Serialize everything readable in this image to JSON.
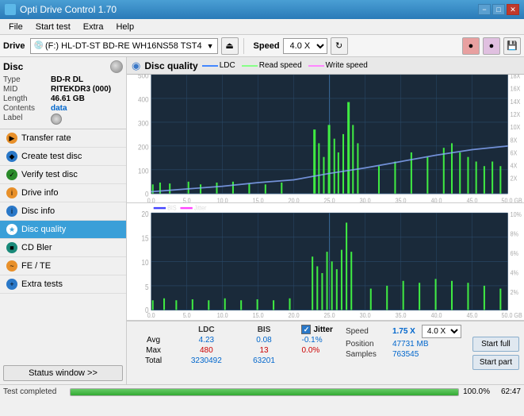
{
  "titlebar": {
    "title": "Opti Drive Control 1.70",
    "minimize": "−",
    "maximize": "□",
    "close": "✕"
  },
  "menubar": {
    "items": [
      "File",
      "Start test",
      "Extra",
      "Help"
    ]
  },
  "toolbar": {
    "drive_label": "Drive",
    "drive_value": "(F:)  HL-DT-ST BD-RE  WH16NS58 TST4",
    "speed_label": "Speed",
    "speed_value": "4.0 X"
  },
  "sidebar": {
    "disc_section": {
      "title": "Disc",
      "rows": [
        {
          "key": "Type",
          "value": "BD-R DL",
          "style": "normal"
        },
        {
          "key": "MID",
          "value": "RITEKDR3 (000)",
          "style": "normal"
        },
        {
          "key": "Length",
          "value": "46.61 GB",
          "style": "normal"
        },
        {
          "key": "Contents",
          "value": "data",
          "style": "blue"
        },
        {
          "key": "Label",
          "value": "",
          "style": "normal"
        }
      ]
    },
    "menu_items": [
      {
        "label": "Transfer rate",
        "icon": "orange",
        "active": false
      },
      {
        "label": "Create test disc",
        "icon": "blue",
        "active": false
      },
      {
        "label": "Verify test disc",
        "icon": "green",
        "active": false
      },
      {
        "label": "Drive info",
        "icon": "orange",
        "active": false
      },
      {
        "label": "Disc info",
        "icon": "blue",
        "active": false
      },
      {
        "label": "Disc quality",
        "icon": "cyan",
        "active": true
      },
      {
        "label": "CD Bler",
        "icon": "teal",
        "active": false
      },
      {
        "label": "FE / TE",
        "icon": "orange",
        "active": false
      },
      {
        "label": "Extra tests",
        "icon": "blue",
        "active": false
      }
    ],
    "status_btn": "Status window >>"
  },
  "content": {
    "title": "Disc quality",
    "legend": [
      {
        "label": "LDC",
        "color": "ldc"
      },
      {
        "label": "Read speed",
        "color": "read"
      },
      {
        "label": "Write speed",
        "color": "write"
      }
    ],
    "chart1": {
      "y_max": 500,
      "y_labels": [
        "500",
        "400",
        "300",
        "200",
        "100",
        "0"
      ],
      "y_right": [
        "18X",
        "16X",
        "14X",
        "12X",
        "10X",
        "8X",
        "6X",
        "4X",
        "2X"
      ],
      "x_labels": [
        "0.0",
        "5.0",
        "10.0",
        "15.0",
        "20.0",
        "25.0",
        "30.0",
        "35.0",
        "40.0",
        "45.0",
        "50.0 GB"
      ]
    },
    "chart2": {
      "legend": [
        "BIS",
        "Jitter"
      ],
      "y_max": 20,
      "y_labels": [
        "20",
        "15",
        "10",
        "5",
        "0"
      ],
      "y_right": [
        "10%",
        "8%",
        "6%",
        "4%",
        "2%"
      ],
      "x_labels": [
        "0.0",
        "5.0",
        "10.0",
        "15.0",
        "20.0",
        "25.0",
        "30.0",
        "35.0",
        "40.0",
        "45.0",
        "50.0 GB"
      ]
    }
  },
  "stats": {
    "columns": [
      "",
      "LDC",
      "BIS",
      "",
      "Jitter",
      "Speed",
      "1.75 X",
      "4.0 X"
    ],
    "rows": [
      {
        "label": "Avg",
        "ldc": "4.23",
        "bis": "0.08",
        "jitter": "-0.1%"
      },
      {
        "label": "Max",
        "ldc": "480",
        "bis": "13",
        "jitter": "0.0%"
      },
      {
        "label": "Total",
        "ldc": "3230492",
        "bis": "63201",
        "jitter": ""
      }
    ],
    "position_label": "Position",
    "position_value": "47731 MB",
    "samples_label": "Samples",
    "samples_value": "763545"
  },
  "buttons": {
    "start_full": "Start full",
    "start_part": "Start part"
  },
  "progress": {
    "label": "Test completed",
    "percent": 100.0,
    "percent_display": "100.0%",
    "time": "62:47"
  }
}
